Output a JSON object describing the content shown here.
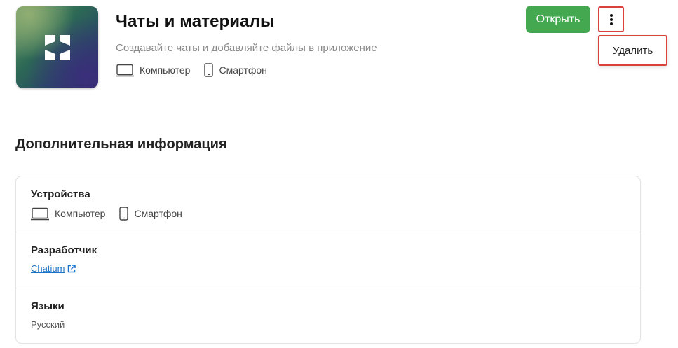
{
  "app": {
    "title": "Чаты и материалы",
    "subtitle": "Создавайте чаты и добавляйте файлы в приложение",
    "icon": "chatium-logo-icon",
    "platforms": [
      "Компьютер",
      "Смартфон"
    ]
  },
  "actions": {
    "open_label": "Открыть",
    "more_icon": "more-vertical-icon",
    "menu_items": [
      "Удалить"
    ]
  },
  "additional_info": {
    "title": "Дополнительная информация",
    "rows": [
      {
        "label": "Устройства",
        "values": [
          "Компьютер",
          "Смартфон"
        ]
      },
      {
        "label": "Разработчик",
        "link": "Chatium",
        "link_icon": "external-link-icon"
      },
      {
        "label": "Языки",
        "value": "Русский"
      }
    ]
  },
  "colors": {
    "accent_green": "#43a84f",
    "highlight_red": "#d9413b",
    "link_blue": "#1a73c8"
  }
}
